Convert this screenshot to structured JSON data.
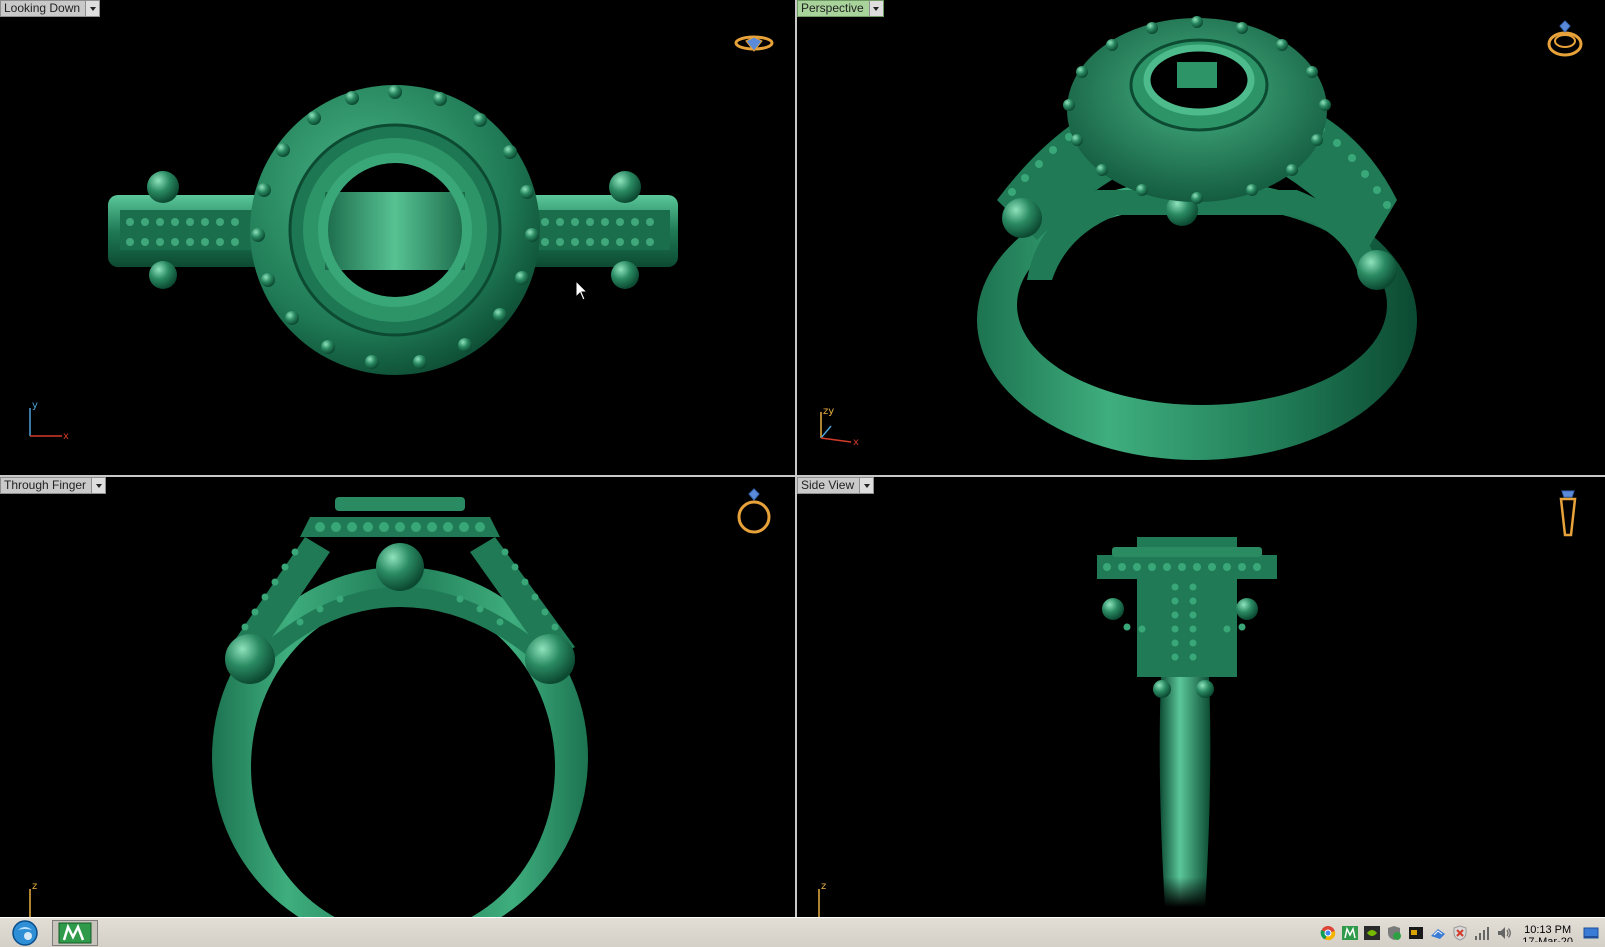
{
  "viewports": {
    "top_left": {
      "label": "Looking Down",
      "active": false
    },
    "top_right": {
      "label": "Perspective",
      "active": true
    },
    "bottom_left": {
      "label": "Through Finger",
      "active": false
    },
    "bottom_right": {
      "label": "Side View",
      "active": false
    }
  },
  "axes": {
    "top_left": {
      "a": "y",
      "b": "x"
    },
    "top_right": {
      "a": "zy",
      "b": "x"
    },
    "bottom_left": {
      "a": "z",
      "b": ""
    },
    "bottom_right": {
      "a": "z",
      "b": ""
    }
  },
  "colors": {
    "model": "#2a8a62",
    "model_dark": "#0c4a32",
    "model_light": "#5bc79a",
    "gizmo": "#e8a23a",
    "gizmo_gem": "#5a8ad8",
    "axis_x": "#d23a2a",
    "axis_y": "#4aa0d8",
    "axis_z": "#e8b040"
  },
  "taskbar": {
    "start_icon": "start-orb-icon",
    "open_app_icon": "matrix-app-icon",
    "tray_icons": [
      "chrome-icon",
      "matrix-tray-icon",
      "nvidia-icon",
      "security-shield-icon",
      "terminal-icon",
      "network-tool-icon",
      "antivirus-icon",
      "signal-bars-icon",
      "speaker-icon"
    ],
    "time": "10:13 PM",
    "date": "17-Mar-20",
    "show_desktop_icon": "show-desktop-icon"
  }
}
